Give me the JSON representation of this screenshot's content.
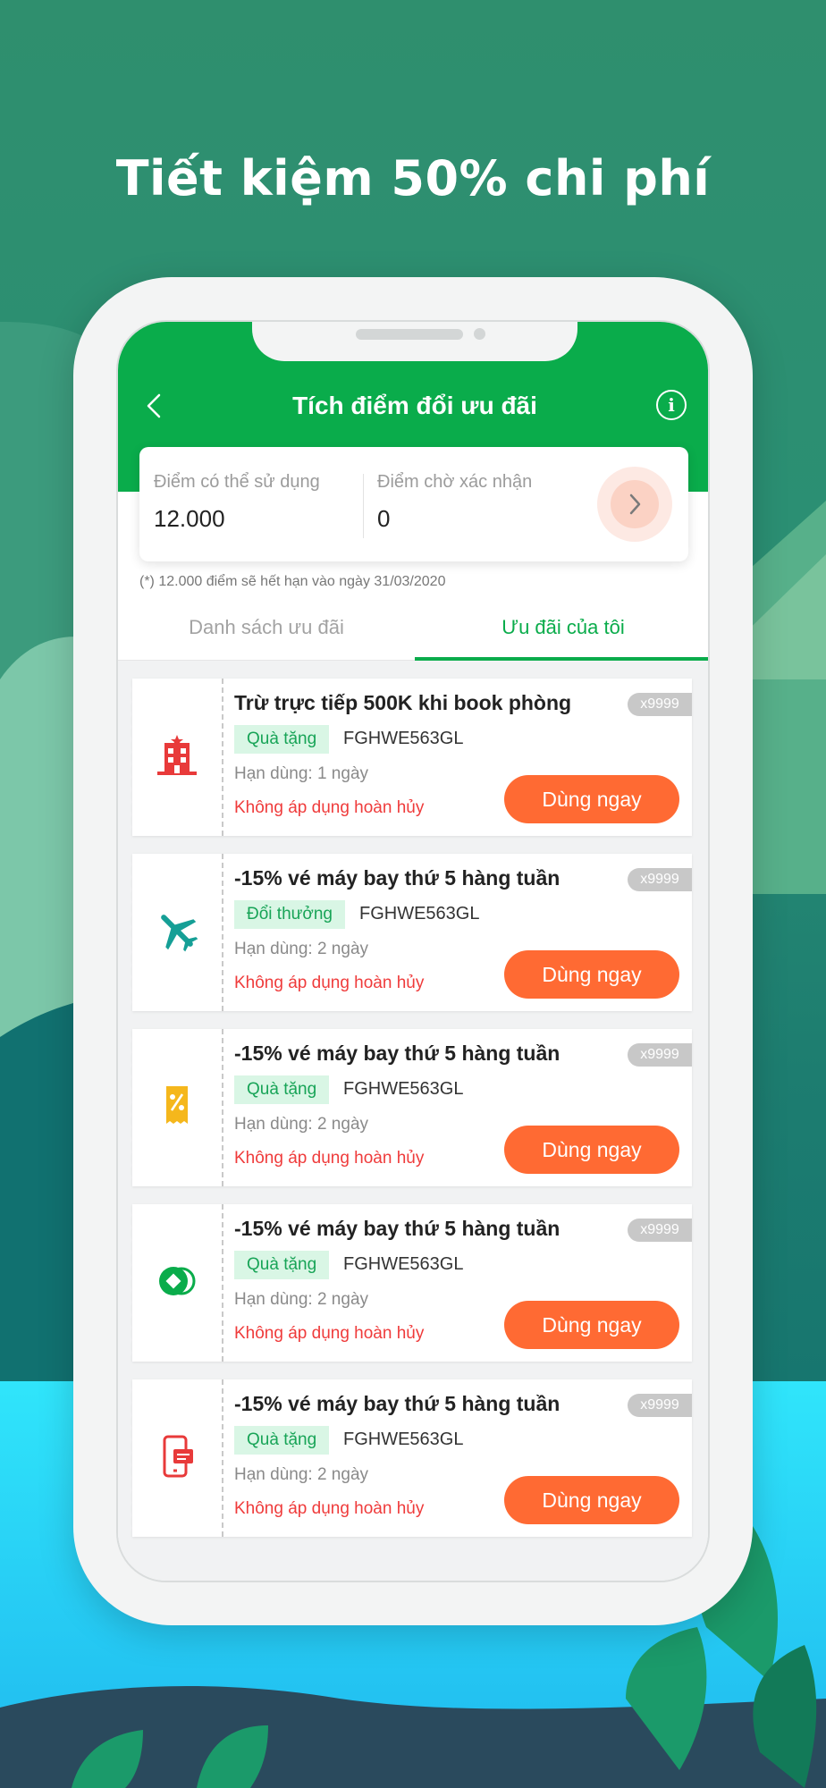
{
  "hero": {
    "title": "Tiết kiệm 50% chi phí"
  },
  "colors": {
    "brand_green": "#0aac4b",
    "action_orange": "#ff6a33",
    "warning_red": "#ef3b3b",
    "tag_green_bg": "#d9f6e5"
  },
  "header": {
    "title": "Tích điểm đổi ưu đãi",
    "back_icon": "chevron-left-icon",
    "info_icon": "info-icon"
  },
  "points": {
    "available_label": "Điểm có thể sử dụng",
    "available_value": "12.000",
    "pending_label": "Điểm chờ xác nhận",
    "pending_value": "0",
    "go_icon": "chevron-right-icon"
  },
  "expire_note": "(*) 12.000 điểm sẽ hết hạn vào ngày 31/03/2020",
  "tabs": [
    {
      "label": "Danh sách ưu đãi",
      "active": false
    },
    {
      "label": "Ưu đãi của tôi",
      "active": true
    }
  ],
  "coupons": [
    {
      "icon": "hotel-icon",
      "title": "Trừ trực tiếp 500K khi book phòng",
      "qty": "x9999",
      "tag": "Quà tặng",
      "code": "FGHWE563GL",
      "expiry": "Hạn dùng: 1 ngày",
      "note": "Không áp dụng hoàn hủy",
      "button": "Dùng ngay"
    },
    {
      "icon": "airplane-icon",
      "title": "-15% vé máy bay thứ 5 hàng tuần",
      "qty": "x9999",
      "tag": "Đổi thưởng",
      "code": "FGHWE563GL",
      "expiry": "Hạn dùng: 2 ngày",
      "note": "Không áp dụng hoàn hủy",
      "button": "Dùng ngay"
    },
    {
      "icon": "discount-voucher-icon",
      "title": "-15% vé máy bay thứ 5 hàng tuần",
      "qty": "x9999",
      "tag": "Quà tặng",
      "code": "FGHWE563GL",
      "expiry": "Hạn dùng: 2 ngày",
      "note": "Không áp dụng hoàn hủy",
      "button": "Dùng ngay"
    },
    {
      "icon": "coins-icon",
      "title": "-15% vé máy bay thứ 5 hàng tuần",
      "qty": "x9999",
      "tag": "Quà tặng",
      "code": "FGHWE563GL",
      "expiry": "Hạn dùng: 2 ngày",
      "note": "Không áp dụng hoàn hủy",
      "button": "Dùng ngay"
    },
    {
      "icon": "mobile-payment-icon",
      "title": "-15% vé máy bay thứ 5 hàng tuần",
      "qty": "x9999",
      "tag": "Quà tặng",
      "code": "FGHWE563GL",
      "expiry": "Hạn dùng: 2 ngày",
      "note": "Không áp dụng hoàn hủy",
      "button": "Dùng ngay"
    }
  ]
}
